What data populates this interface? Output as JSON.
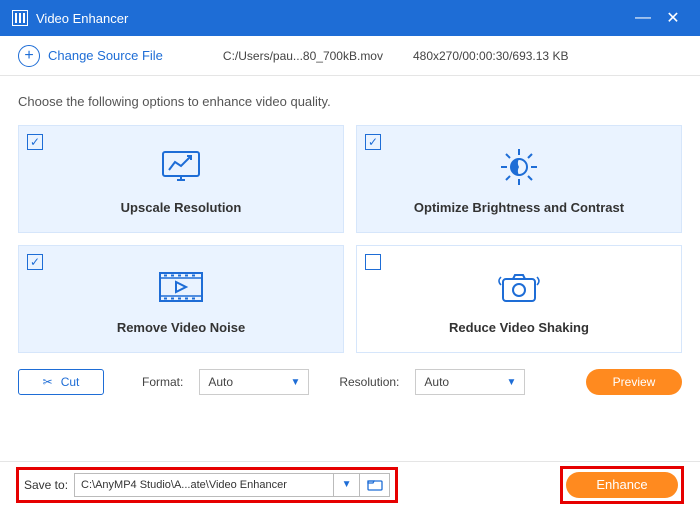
{
  "window": {
    "title": "Video Enhancer"
  },
  "sourcebar": {
    "change_label": "Change Source File",
    "path": "C:/Users/pau...80_700kB.mov",
    "info": "480x270/00:00:30/693.13 KB"
  },
  "instruction": "Choose the following options to enhance video quality.",
  "options": {
    "upscale": {
      "label": "Upscale Resolution",
      "checked": true
    },
    "brightness": {
      "label": "Optimize Brightness and Contrast",
      "checked": true
    },
    "noise": {
      "label": "Remove Video Noise",
      "checked": true
    },
    "shaking": {
      "label": "Reduce Video Shaking",
      "checked": false
    }
  },
  "controls": {
    "cut": "Cut",
    "format_label": "Format:",
    "format_value": "Auto",
    "resolution_label": "Resolution:",
    "resolution_value": "Auto",
    "preview": "Preview"
  },
  "save": {
    "label": "Save to:",
    "path": "C:\\AnyMP4 Studio\\A...ate\\Video Enhancer"
  },
  "enhance": "Enhance"
}
